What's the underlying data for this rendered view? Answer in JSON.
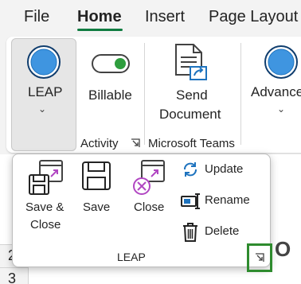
{
  "tabs": [
    "File",
    "Home",
    "Insert",
    "Page Layout"
  ],
  "ribbon": {
    "leap_label": "LEAP",
    "billable_label": "Billable",
    "send_document_line1": "Send",
    "send_document_line2": "Document",
    "advanced_label": "Advance",
    "activity_group": "Activity",
    "microsoft_teams_group": "Microsoft Teams"
  },
  "popup": {
    "save_close_line1": "Save &",
    "save_close_line2": "Close",
    "save_label": "Save",
    "close_label": "Close",
    "update_label": "Update",
    "rename_label": "Rename",
    "delete_label": "Delete",
    "group_label": "LEAP"
  },
  "sheet": {
    "rows": [
      "2",
      "3"
    ],
    "cell_text": "O"
  },
  "colors": {
    "accent_green": "#107c41",
    "highlight_green": "#2e8b2e",
    "leap_blue": "#1e73be",
    "purple": "#b146c2"
  }
}
